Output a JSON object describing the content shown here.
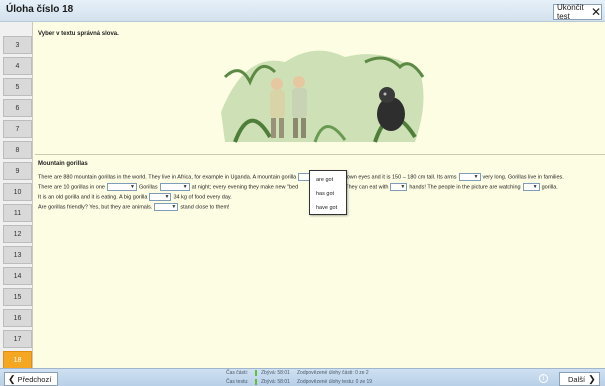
{
  "header": {
    "title": "Úloha číslo 18",
    "end_test_label": "Ukončit test",
    "close_glyph": "✕"
  },
  "sidebar": {
    "questions": [
      "3",
      "4",
      "5",
      "6",
      "7",
      "8",
      "9",
      "10",
      "11",
      "12",
      "13",
      "14",
      "15",
      "16",
      "17",
      "18"
    ],
    "active": "18"
  },
  "exercise": {
    "instruction": "Vyber v textu správná slova.",
    "passage_title": "Mountain gorillas",
    "lines": [
      [
        "There are 880 mountain gorillas in the world. They live in Africa, for example in Uganda. A mountain gorilla",
        "nice brown eyes and it is 150 – 180 cm tall. Its arms",
        "very long. Gorillas live in families."
      ],
      [
        "There are 10 gorillas in one",
        "Gorillas",
        "at night; every evening they make new \"bed",
        "and grass. They can eat with",
        "hands! The people in the picture are watching",
        "gorilla."
      ],
      [
        "It is an old gorilla and it is eating. A big gorilla",
        "34 kg of food every day."
      ],
      [
        "Are gorillas friendly? Yes, but they are animals.",
        "stand close to them!"
      ]
    ],
    "dropdown_options": [
      "are got",
      "has got",
      "have got"
    ]
  },
  "footer": {
    "prev_label": "Předchozí",
    "next_label": "Další",
    "time_part_label": "Čas části:",
    "time_part_remaining": "Zbývá: 58:01",
    "answered_parts": "Zodpovězené úlohy části: 0 ze 2",
    "time_test_label": "Čas testu:",
    "time_test_remaining": "Zbývá: 58:01",
    "answered_test": "Zodpovězené úlohy testu: 0 ze 19",
    "info_glyph": "i"
  },
  "icons": {
    "prev": "chevron-left-icon",
    "next": "chevron-right-icon",
    "close": "close-icon",
    "info": "info-icon"
  },
  "colors": {
    "active_question": "#f5a623",
    "footer_bar": "#b8d0e8",
    "content_bg": "#fdfde4"
  }
}
